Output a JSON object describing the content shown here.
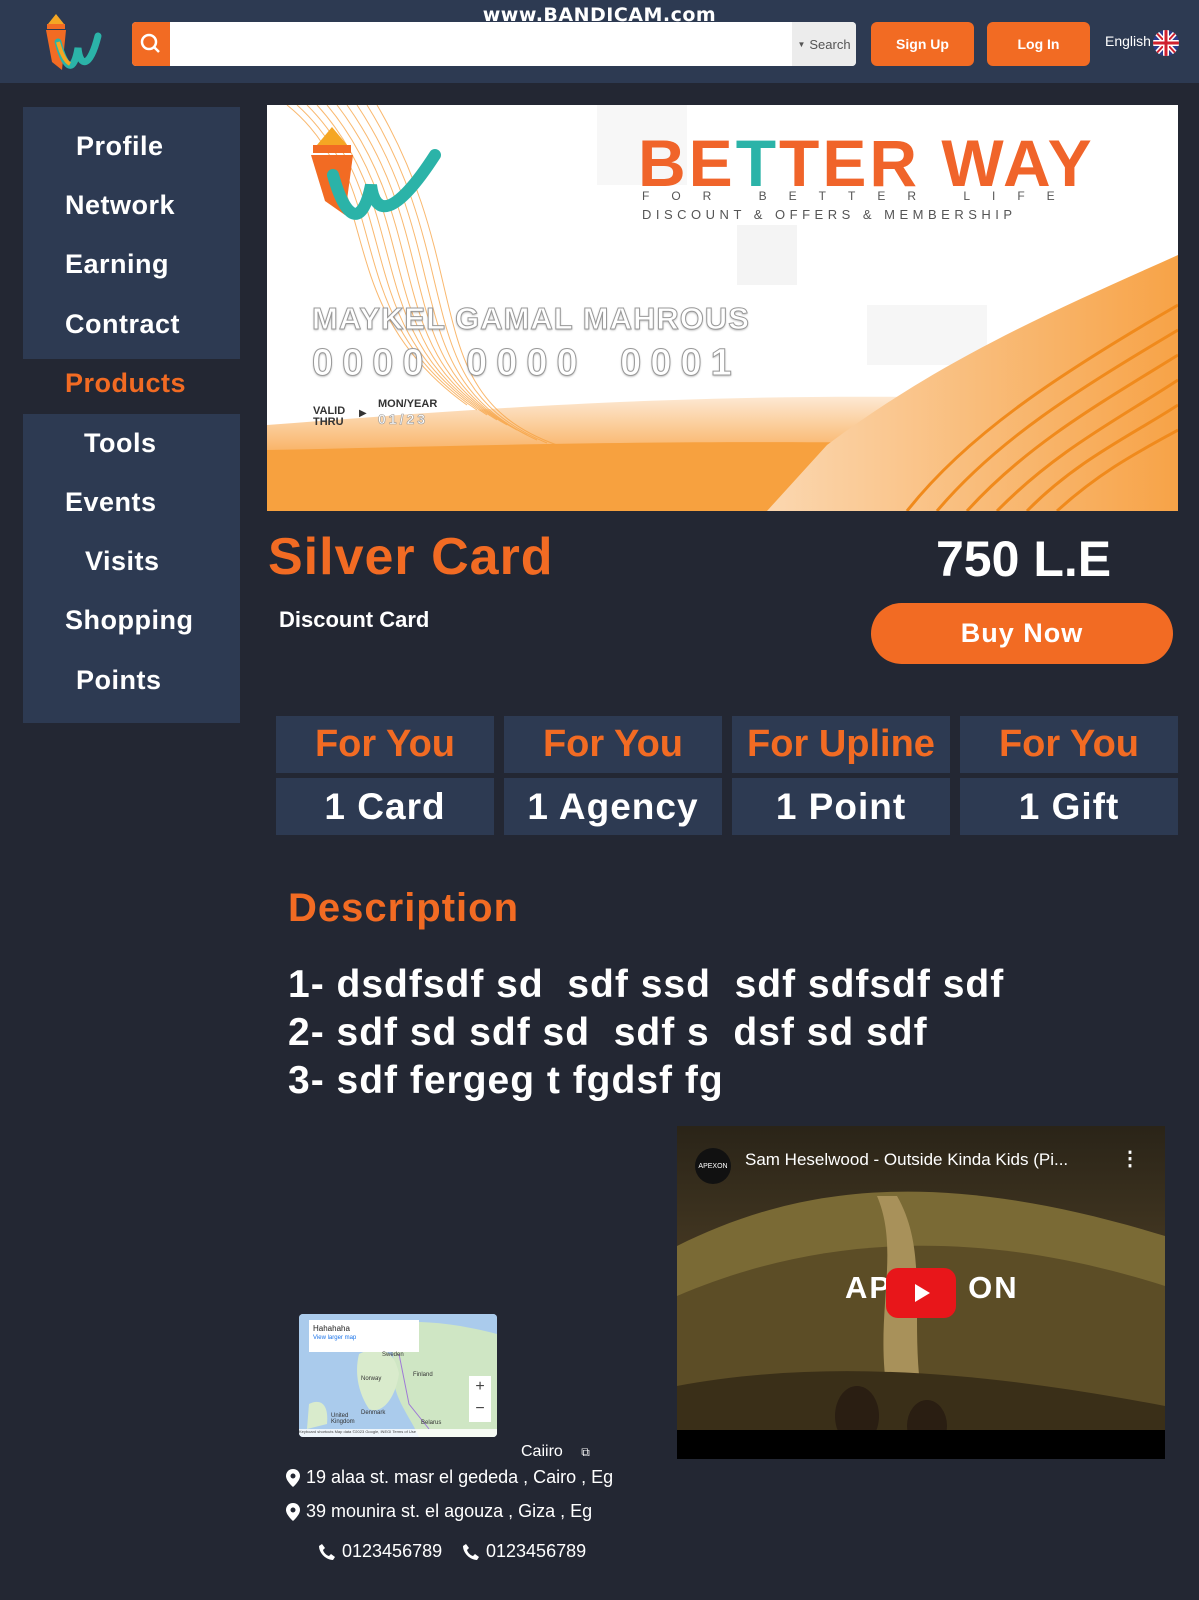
{
  "watermark": "www.BANDICAM.com",
  "header": {
    "search": {
      "value": "",
      "placeholder": "",
      "dropdown_label": "Search"
    },
    "signup_label": "Sign Up",
    "login_label": "Log In",
    "language": "English"
  },
  "sidebar": {
    "items": [
      {
        "label": "Profile",
        "active": false
      },
      {
        "label": "Network",
        "active": false
      },
      {
        "label": "Earning",
        "active": false
      },
      {
        "label": "Contract",
        "active": false
      },
      {
        "label": "Products",
        "active": true
      },
      {
        "label": "Tools",
        "active": false
      },
      {
        "label": "Events",
        "active": false
      },
      {
        "label": "Visits",
        "active": false
      },
      {
        "label": "Shopping",
        "active": false
      },
      {
        "label": "Points",
        "active": false
      }
    ]
  },
  "card": {
    "brand_title_1": "BE",
    "brand_title_2": "T",
    "brand_title_3": "TER WAY",
    "brand_sub1": "FOR BETTER LIFE",
    "brand_sub2": "DISCOUNT & OFFERS & MEMBERSHIP",
    "holder": "MAYKEL GAMAL MAHROUS",
    "number": "0000 0000 0001",
    "valid_label_1": "VALID",
    "valid_label_2": "THRU",
    "monyear_label": "MON/YEAR",
    "expiry": "01/23"
  },
  "product": {
    "title": "Silver Card",
    "price": "750 L.E",
    "subtitle": "Discount Card",
    "buy_label": "Buy Now"
  },
  "benefits": [
    {
      "target": "For You",
      "value": "1 Card"
    },
    {
      "target": "For You",
      "value": "1 Agency"
    },
    {
      "target": "For Upline",
      "value": "1 Point"
    },
    {
      "target": "For You",
      "value": "1 Gift"
    }
  ],
  "description": {
    "title": "Description",
    "lines": [
      "1- dsdfsdf sd  sdf ssd  sdf sdfsdf sdf",
      "2- sdf sd sdf sd  sdf s  dsf sd sdf",
      "3- sdf fergeg t fgdsf fg"
    ]
  },
  "video": {
    "title": "Sam Heselwood - Outside Kinda Kids (Pi...",
    "overlay_left": "AP",
    "overlay_right": "ON",
    "channel": "APEXON"
  },
  "map": {
    "title": "Hahahaha",
    "link": "View larger map",
    "labels": [
      "Sweden",
      "Norway",
      "Finland",
      "Denmark",
      "United Kingdom",
      "Belarus"
    ],
    "zoom_in": "+",
    "zoom_out": "−",
    "footer": "Keyboard shortcuts  Map data ©2023 Google, INEGI  Terms of Use"
  },
  "contact": {
    "city": "Caiiro",
    "addresses": [
      "19 alaa st. masr el gededa , Cairo , Eg",
      "39 mounira st. el agouza , Giza , Eg"
    ],
    "phones": [
      "0123456789",
      "0123456789"
    ]
  },
  "colors": {
    "accent": "#f26b23",
    "panel": "#2d3a52",
    "background": "#232733"
  }
}
